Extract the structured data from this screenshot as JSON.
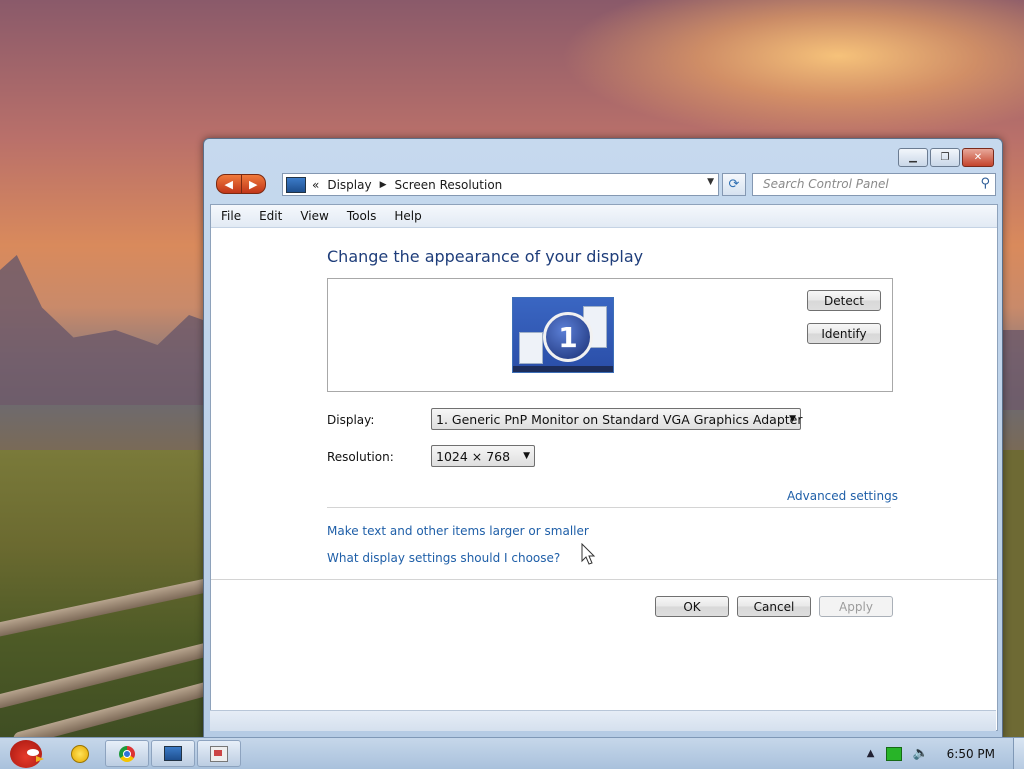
{
  "window": {
    "caption_buttons": {
      "minimize_icon": "minimize-icon",
      "maximize_icon": "maximize-icon",
      "close_icon": "close-icon"
    }
  },
  "navigation": {
    "back_icon": "back-arrow-icon",
    "forward_icon": "forward-arrow-icon",
    "address": {
      "overflow": "«",
      "crumbs": [
        "Display",
        "Screen Resolution"
      ]
    },
    "search_placeholder": "Search Control Panel"
  },
  "menu": [
    "File",
    "Edit",
    "View",
    "Tools",
    "Help"
  ],
  "main": {
    "title": "Change the appearance of your display",
    "monitor_number": "1",
    "detect_label": "Detect",
    "identify_label": "Identify",
    "display_label": "Display:",
    "display_value": "1. Generic PnP Monitor on Standard VGA Graphics Adapter",
    "resolution_label": "Resolution:",
    "resolution_value": "1024 × 768",
    "advanced_link": "Advanced settings",
    "link_text_size": "Make text and other items larger or smaller",
    "link_help": "What display settings should I choose?",
    "ok_label": "OK",
    "cancel_label": "Cancel",
    "apply_label": "Apply"
  },
  "taskbar": {
    "clock": "6:50 PM",
    "pinned": [
      "sun-icon",
      "chrome-icon",
      "display-icon",
      "tool-icon"
    ]
  },
  "colors": {
    "link": "#1f5fa8",
    "title": "#1e3d7a",
    "nav_arrow": "#d9521f"
  }
}
